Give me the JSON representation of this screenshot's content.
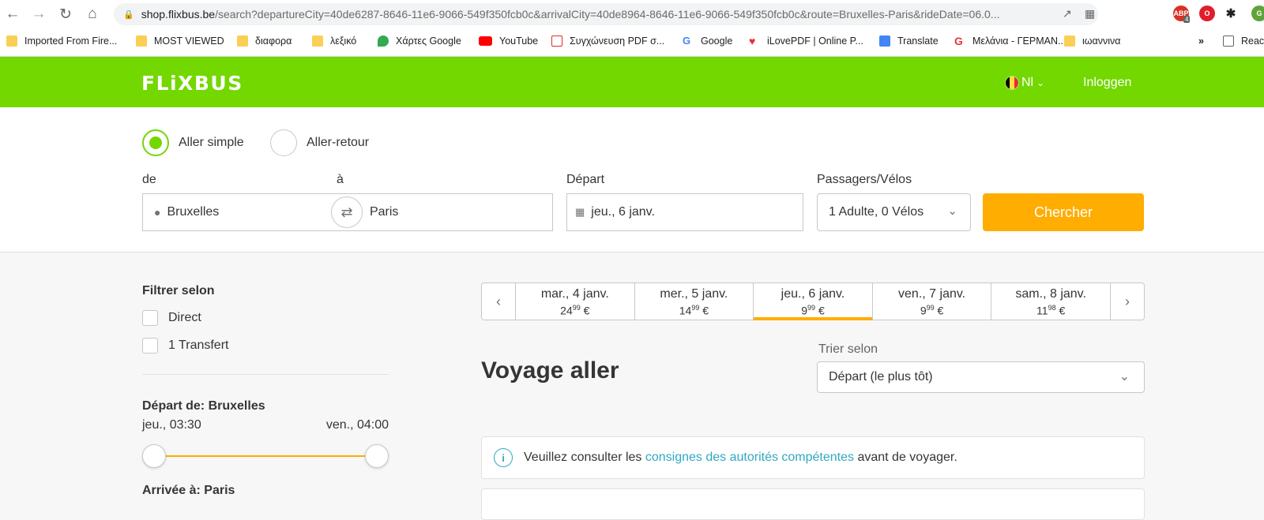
{
  "browser": {
    "url_host": "shop.flixbus.be",
    "url_path": "/search?departureCity=40de6287-8646-11e6-9066-549f350fcb0c&arrivalCity=40de8964-8646-11e6-9066-549f350fcb0c&route=Bruxelles-Paris&rideDate=06.0...",
    "ext_badge": "4",
    "bookmarks": [
      {
        "label": "Imported From Fire...",
        "icon": "folder-icon"
      },
      {
        "label": "MOST VIEWED",
        "icon": "folder-icon"
      },
      {
        "label": "διαφορα",
        "icon": "folder-icon"
      },
      {
        "label": "λεξικό",
        "icon": "folder-icon"
      },
      {
        "label": "Χάρτες Google",
        "icon": "maps-icon"
      },
      {
        "label": "YouTube",
        "icon": "youtube-icon"
      },
      {
        "label": "Συγχώνευση PDF σ...",
        "icon": "pdf-icon"
      },
      {
        "label": "Google",
        "icon": "google-icon"
      },
      {
        "label": "iLovePDF | Online P...",
        "icon": "heart-icon"
      },
      {
        "label": "Translate",
        "icon": "translate-icon"
      },
      {
        "label": "Μελάνια - ΓΕΡΜΑΝ...",
        "icon": "g-icon"
      },
      {
        "label": "ιωαννινα",
        "icon": "folder-icon"
      }
    ],
    "more": "»",
    "reading_list": "Reac"
  },
  "header": {
    "logo": "FLiXBUS",
    "lang": "Nl",
    "login": "Inloggen"
  },
  "search": {
    "one_way": "Aller simple",
    "round_trip": "Aller-retour",
    "from_label": "de",
    "to_label": "à",
    "from_value": "Bruxelles",
    "to_value": "Paris",
    "departure_label": "Départ",
    "departure_value": "jeu., 6 janv.",
    "passengers_label": "Passagers/Vélos",
    "passengers_value": "1 Adulte, 0 Vélos",
    "search_button": "Chercher"
  },
  "filters": {
    "title": "Filtrer selon",
    "direct": "Direct",
    "transfer": "1 Transfert",
    "departure_title": "Départ de: Bruxelles",
    "departure_min": "jeu., 03:30",
    "departure_max": "ven., 04:00",
    "arrival_title": "Arrivée à: Paris"
  },
  "dates": [
    {
      "day": "mar., 4 janv.",
      "price_int": "24",
      "price_dec": "99",
      "currency": "€"
    },
    {
      "day": "mer., 5 janv.",
      "price_int": "14",
      "price_dec": "99",
      "currency": "€"
    },
    {
      "day": "jeu., 6 janv.",
      "price_int": "9",
      "price_dec": "99",
      "currency": "€"
    },
    {
      "day": "ven., 7 janv.",
      "price_int": "9",
      "price_dec": "99",
      "currency": "€"
    },
    {
      "day": "sam., 8 janv.",
      "price_int": "11",
      "price_dec": "98",
      "currency": "€"
    }
  ],
  "results": {
    "title": "Voyage aller",
    "sort_label": "Trier selon",
    "sort_value": "Départ (le plus tôt)",
    "notice_before": "Veuillez consulter les ",
    "notice_link": "consignes des autorités compétentes",
    "notice_after": " avant de voyager."
  },
  "colors": {
    "brand": "#73d700",
    "accent": "#ffad00",
    "link": "#31a8c3"
  }
}
